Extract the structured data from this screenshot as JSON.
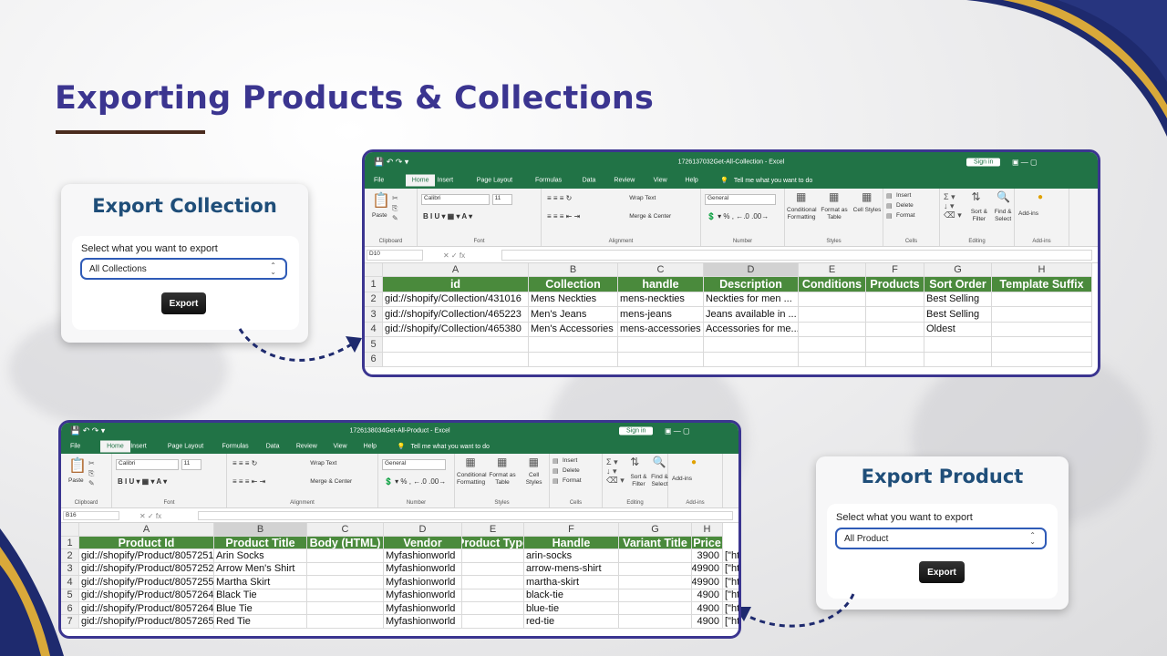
{
  "page": {
    "title": "Exporting Products & Collections",
    "colors": {
      "title": "#3b3590",
      "card_title": "#1f4e79",
      "excel_green": "#217346",
      "header_green": "#4a8a3c",
      "frame": "#3b3590"
    }
  },
  "collection_card": {
    "title": "Export Collection",
    "label": "Select what you want to export",
    "selected": "All Collections",
    "button": "Export"
  },
  "product_card": {
    "title": "Export Product",
    "label": "Select what you want to export",
    "selected": "All Product",
    "button": "Export"
  },
  "excel_ui": {
    "sign_in": "Sign in",
    "tabs": [
      "File",
      "Home",
      "Insert",
      "Page Layout",
      "Formulas",
      "Data",
      "Review",
      "View",
      "Help"
    ],
    "tell_me": "Tell me what you want to do",
    "font_name": "Calibri",
    "font_size": "11",
    "number_format": "General",
    "wrap_text": "Wrap Text",
    "merge_center": "Merge & Center",
    "paste": "Paste",
    "cond_format": "Conditional Formatting",
    "format_table": "Format as Table",
    "cell_styles": "Cell Styles",
    "insert": "Insert",
    "delete": "Delete",
    "format": "Format",
    "sort_filter": "Sort & Filter",
    "find_select": "Find & Select",
    "addins": "Add-ins",
    "groups": [
      "Clipboard",
      "Font",
      "Alignment",
      "Number",
      "Styles",
      "Cells",
      "Editing",
      "Add-ins"
    ]
  },
  "collection_sheet": {
    "window_title": "1726137032Get-All-Collection - Excel",
    "name_box": "D10",
    "columns": [
      "A",
      "B",
      "C",
      "D",
      "E",
      "F",
      "G",
      "H"
    ],
    "header": [
      "id",
      "Collection",
      "handle",
      "Description",
      "Conditions",
      "Products",
      "Sort Order",
      "Template Suffix"
    ],
    "rows": [
      [
        "gid://shopify/Collection/431016",
        "Mens Neckties",
        "mens-neckties",
        "Neckties for men ...",
        "",
        "",
        "Best Selling",
        ""
      ],
      [
        "gid://shopify/Collection/465223",
        "Men's Jeans",
        "mens-jeans",
        "Jeans available in ...",
        "",
        "",
        "Best Selling",
        ""
      ],
      [
        "gid://shopify/Collection/465380",
        "Men's Accessories",
        "mens-accessories",
        "Accessories for me...",
        "",
        "",
        "Oldest",
        ""
      ],
      [
        "",
        "",
        "",
        "",
        "",
        "",
        "",
        ""
      ],
      [
        "",
        "",
        "",
        "",
        "",
        "",
        "",
        ""
      ]
    ]
  },
  "product_sheet": {
    "window_title": "1726138034Get-All-Product - Excel",
    "name_box": "B16",
    "columns": [
      "A",
      "B",
      "C",
      "D",
      "E",
      "F",
      "G",
      "H"
    ],
    "header": [
      "Product Id",
      "Product Title",
      "Body (HTML)",
      "Vendor",
      "Product Type",
      "Handle",
      "Variant Title",
      "Price"
    ],
    "rows": [
      [
        "gid://shopify/Product/8057251",
        "Arin Socks",
        "",
        "Myfashionworld",
        "",
        "arin-socks",
        "",
        "3900",
        "[\"htt"
      ],
      [
        "gid://shopify/Product/8057252",
        "Arrow Men's Shirt",
        "",
        "Myfashionworld",
        "",
        "arrow-mens-shirt",
        "",
        "49900",
        "[\"htt"
      ],
      [
        "gid://shopify/Product/8057255",
        "Martha Skirt",
        "",
        "Myfashionworld",
        "",
        "martha-skirt",
        "",
        "49900",
        "[\"htt"
      ],
      [
        "gid://shopify/Product/8057264",
        "Black Tie",
        "",
        "Myfashionworld",
        "",
        "black-tie",
        "",
        "4900",
        "[\"htt"
      ],
      [
        "gid://shopify/Product/8057264",
        "Blue Tie",
        "",
        "Myfashionworld",
        "",
        "blue-tie",
        "",
        "4900",
        "[\"htt"
      ],
      [
        "gid://shopify/Product/8057265",
        "Red Tie",
        "",
        "Myfashionworld",
        "",
        "red-tie",
        "",
        "4900",
        "[\"ht"
      ]
    ]
  }
}
